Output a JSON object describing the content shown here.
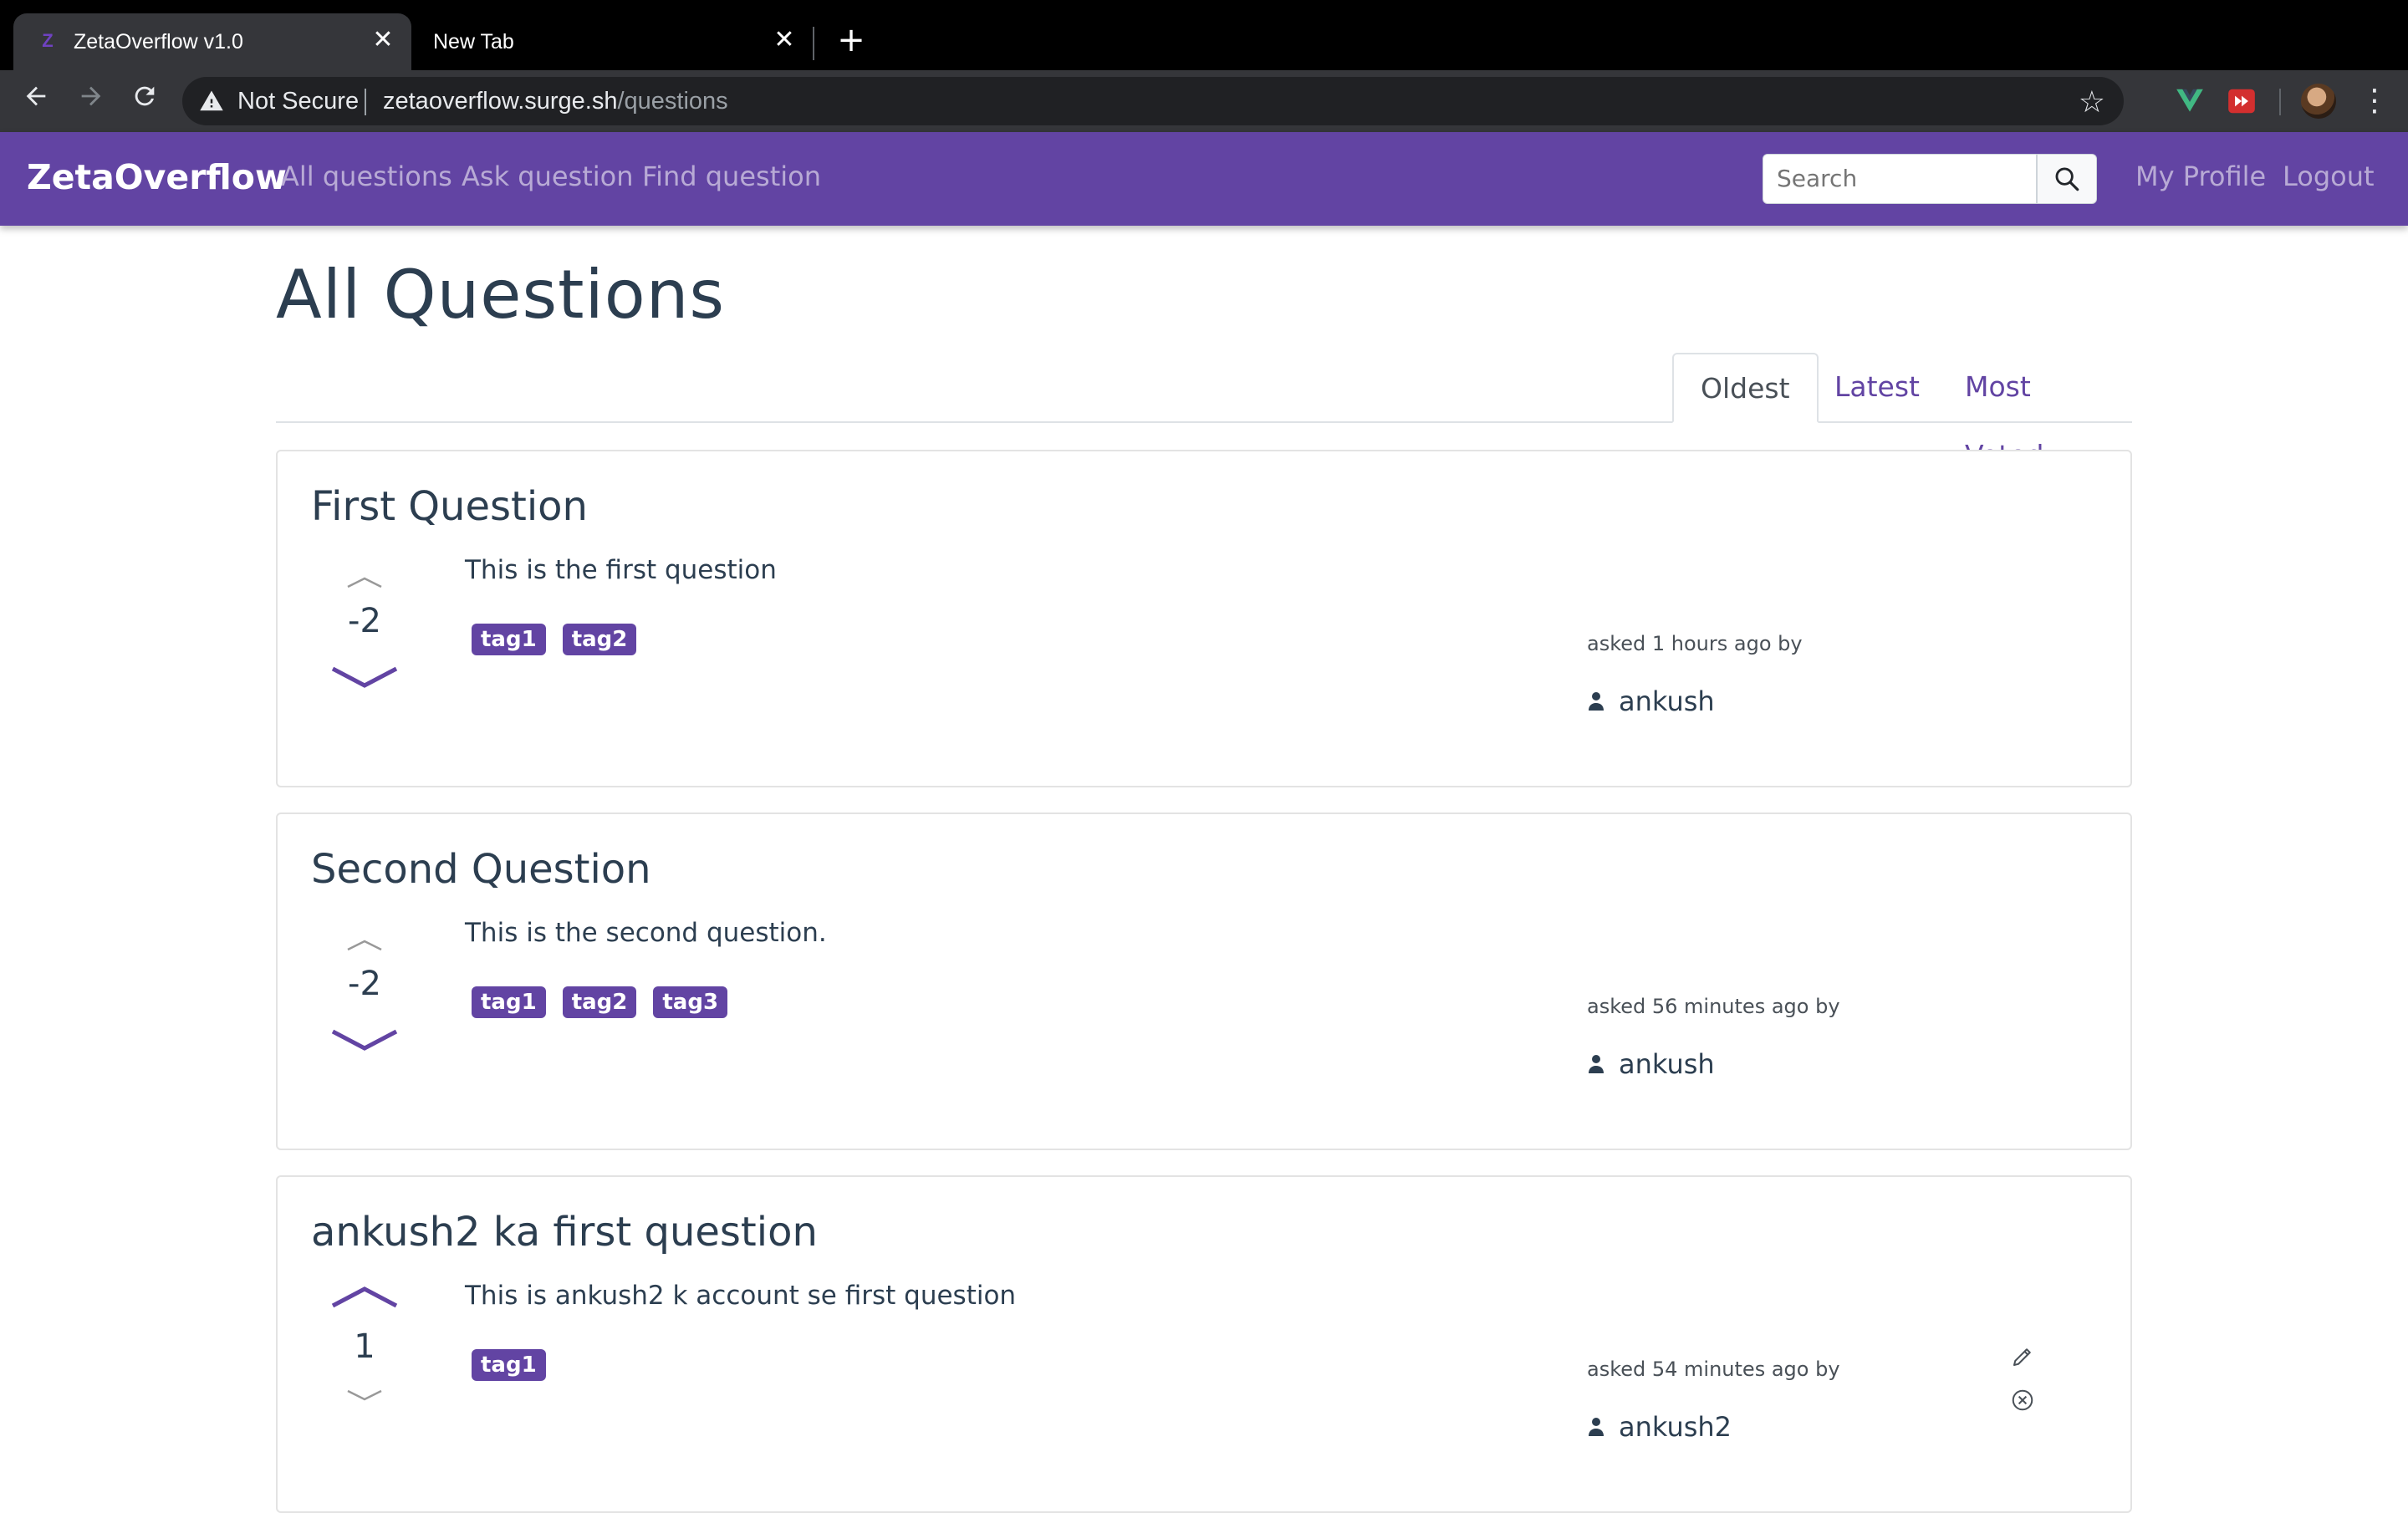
{
  "browser": {
    "tabs": [
      {
        "title": "ZetaOverflow v1.0",
        "favicon": "Z",
        "active": true
      },
      {
        "title": "New Tab",
        "active": false
      }
    ],
    "close_glyph": "✕",
    "new_tab_glyph": "+",
    "security_label": "Not Secure",
    "url_host": "zetaoverflow.surge.sh",
    "url_path": "/questions"
  },
  "navbar": {
    "brand": "ZetaOverflow",
    "links": [
      "All questions",
      "Ask question",
      "Find question"
    ],
    "search_placeholder": "Search",
    "profile": "My Profile",
    "logout": "Logout",
    "color": "#6244a3"
  },
  "page": {
    "title": "All Questions",
    "sort_tabs": [
      "Oldest",
      "Latest",
      "Most Voted"
    ],
    "active_sort": "Oldest"
  },
  "questions": [
    {
      "title": "First Question",
      "body": "This is the first question",
      "votes": "-2",
      "vote_state": "down",
      "tags": [
        "tag1",
        "tag2"
      ],
      "asked": "asked 1 hours ago by",
      "author": "ankush",
      "owned": false
    },
    {
      "title": "Second Question",
      "body": "This is the second question.",
      "votes": "-2",
      "vote_state": "down",
      "tags": [
        "tag1",
        "tag2",
        "tag3"
      ],
      "asked": "asked 56 minutes ago by",
      "author": "ankush",
      "owned": false
    },
    {
      "title": "ankush2 ka first question",
      "body": "This is ankush2 k account se first question",
      "votes": "1",
      "vote_state": "up",
      "tags": [
        "tag1"
      ],
      "asked": "asked 54 minutes ago by",
      "author": "ankush2",
      "owned": true
    }
  ]
}
